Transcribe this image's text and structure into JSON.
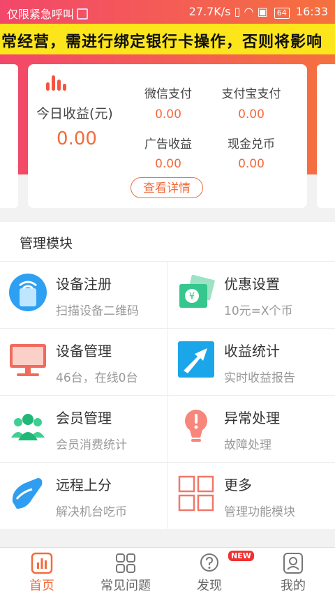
{
  "status_bar": {
    "carrier": "仅限紧急呼叫",
    "speed": "27.7K/s",
    "battery": "64",
    "time": "16:33"
  },
  "marquee": {
    "text": "常经营，需进行绑定银行卡操作，否则将影响"
  },
  "summary": {
    "today_label": "今日收益(元)",
    "today_value": "0.00",
    "stats": [
      {
        "label": "微信支付",
        "value": "0.00"
      },
      {
        "label": "支付宝支付",
        "value": "0.00"
      },
      {
        "label": "广告收益",
        "value": "0.00"
      },
      {
        "label": "现金兑币",
        "value": "0.00"
      }
    ],
    "detail_button": "查看详情"
  },
  "modules": {
    "title": "管理模块",
    "items": [
      {
        "title": "设备注册",
        "subtitle": "扫描设备二维码",
        "icon": "device-register-icon"
      },
      {
        "title": "优惠设置",
        "subtitle": "10元=X个币",
        "icon": "discount-ticket-icon"
      },
      {
        "title": "设备管理",
        "subtitle": "46台，在线0台",
        "icon": "monitor-icon"
      },
      {
        "title": "收益统计",
        "subtitle": "实时收益报告",
        "icon": "trend-arrow-icon"
      },
      {
        "title": "会员管理",
        "subtitle": "会员消费统计",
        "icon": "members-icon"
      },
      {
        "title": "异常处理",
        "subtitle": "故障处理",
        "icon": "alert-bulb-icon"
      },
      {
        "title": "远程上分",
        "subtitle": "解决机台吃币",
        "icon": "remote-hand-icon"
      },
      {
        "title": "更多",
        "subtitle": "管理功能模块",
        "icon": "grid-more-icon"
      }
    ]
  },
  "tabs": [
    {
      "label": "首页",
      "icon": "home-chart-icon",
      "active": true
    },
    {
      "label": "常见问题",
      "icon": "faq-grid-icon"
    },
    {
      "label": "发现",
      "icon": "discover-icon",
      "badge": "NEW"
    },
    {
      "label": "我的",
      "icon": "profile-icon"
    }
  ],
  "colors": {
    "accent": "#f36b3c",
    "marquee_bg": "#fde51b",
    "badge": "#f23030"
  }
}
